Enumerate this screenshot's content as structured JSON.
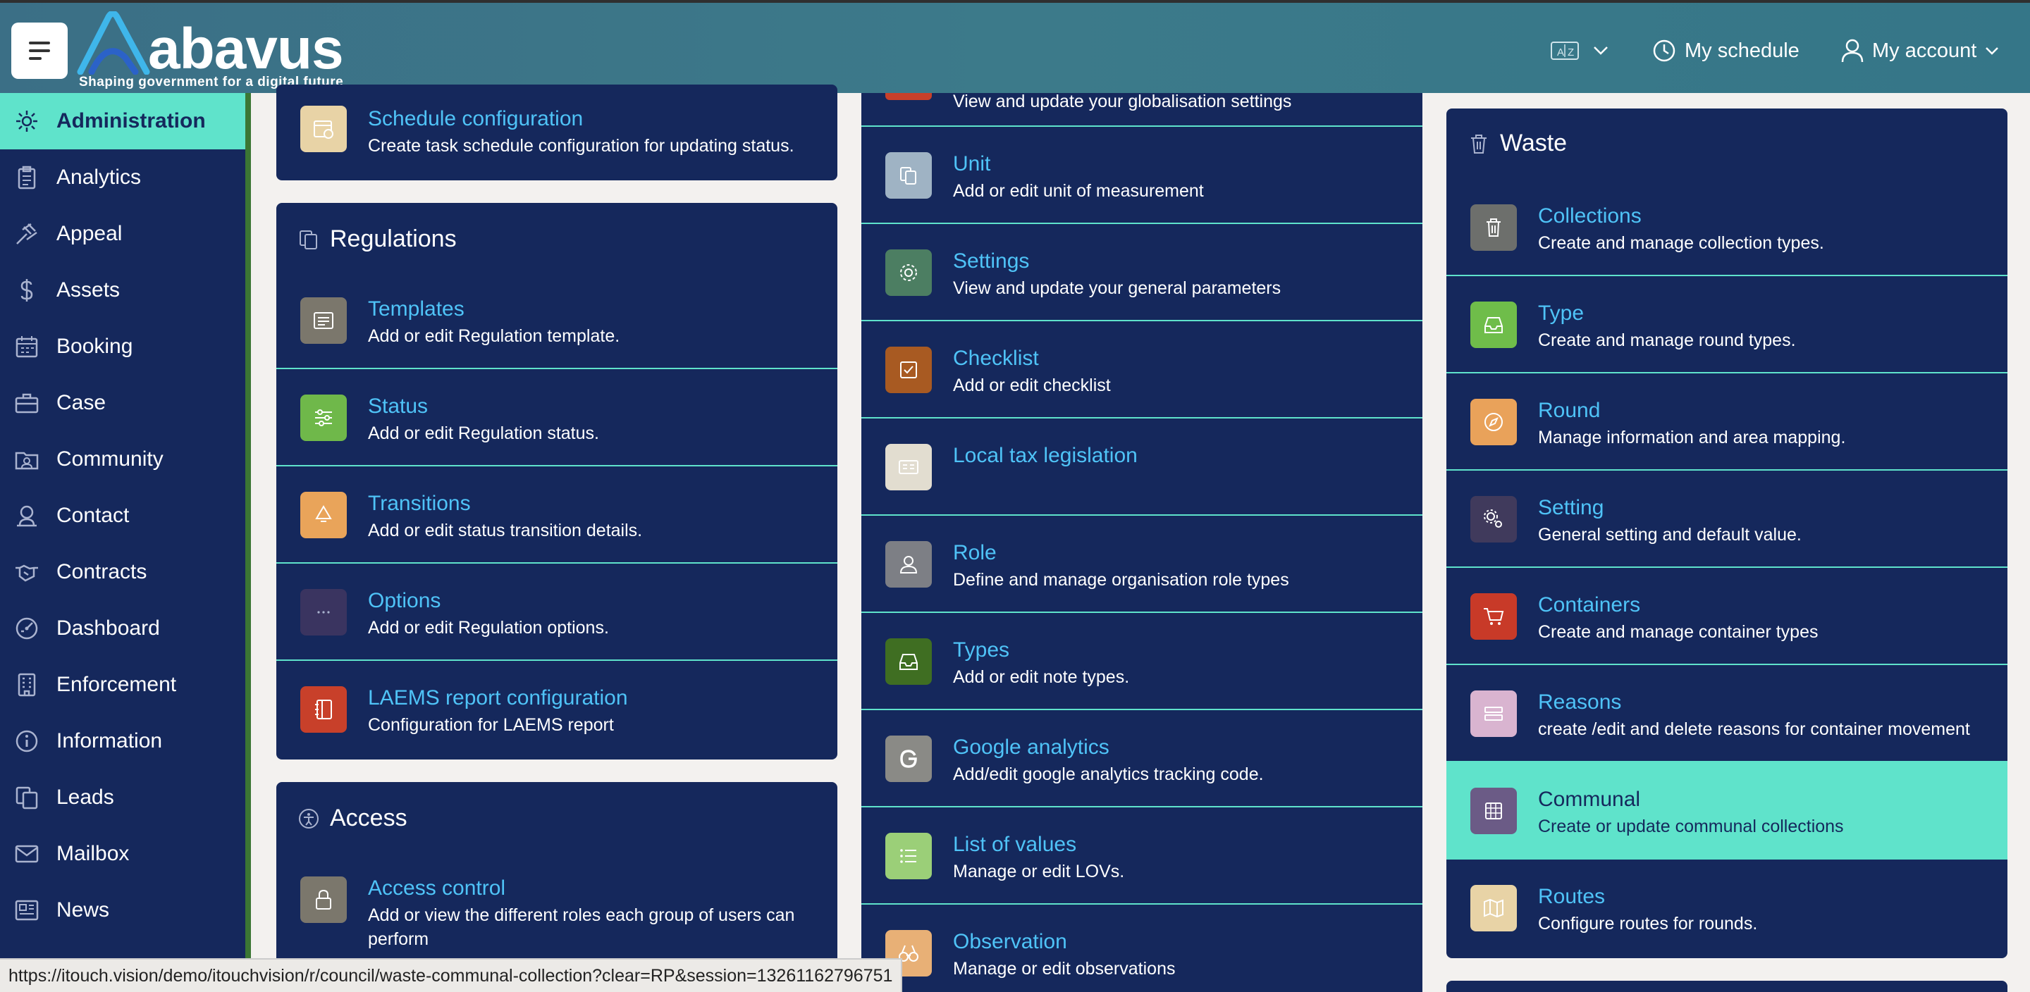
{
  "header": {
    "logo_text": "abavus",
    "tagline": "Shaping government for a digital future",
    "language_icon": "translate-icon",
    "my_schedule": "My schedule",
    "my_account": "My account"
  },
  "sidebar": {
    "items": [
      {
        "label": "Administration",
        "icon": "gear-icon"
      },
      {
        "label": "Analytics",
        "icon": "clipboard-icon"
      },
      {
        "label": "Appeal",
        "icon": "gavel-icon"
      },
      {
        "label": "Assets",
        "icon": "dollar-icon"
      },
      {
        "label": "Booking",
        "icon": "calendar-icon"
      },
      {
        "label": "Case",
        "icon": "briefcase-icon"
      },
      {
        "label": "Community",
        "icon": "community-icon"
      },
      {
        "label": "Contact",
        "icon": "contact-icon"
      },
      {
        "label": "Contracts",
        "icon": "handshake-icon"
      },
      {
        "label": "Dashboard",
        "icon": "dashboard-icon"
      },
      {
        "label": "Enforcement",
        "icon": "building-icon"
      },
      {
        "label": "Information",
        "icon": "info-icon"
      },
      {
        "label": "Leads",
        "icon": "copy-icon"
      },
      {
        "label": "Mailbox",
        "icon": "mail-icon"
      },
      {
        "label": "News",
        "icon": "newspaper-icon"
      }
    ]
  },
  "col1": {
    "schedule": {
      "title": "Schedule configuration",
      "desc": "Create task schedule configuration for updating status."
    },
    "regulations": {
      "title": "Regulations",
      "rows": [
        {
          "title": "Templates",
          "desc": "Add or edit Regulation template."
        },
        {
          "title": "Status",
          "desc": "Add or edit Regulation status."
        },
        {
          "title": "Transitions",
          "desc": "Add or edit status transition details."
        },
        {
          "title": "Options",
          "desc": "Add or edit Regulation options."
        },
        {
          "title": "LAEMS report configuration",
          "desc": "Configuration for LAEMS report"
        }
      ]
    },
    "access": {
      "title": "Access",
      "rows": [
        {
          "title": "Access control",
          "desc": "Add or view the different roles each group of users can perform"
        }
      ]
    }
  },
  "col2": {
    "partial_desc": "View and update your globalisation settings",
    "rows": [
      {
        "title": "Unit",
        "desc": "Add or edit unit of measurement"
      },
      {
        "title": "Settings",
        "desc": "View and update your general parameters"
      },
      {
        "title": "Checklist",
        "desc": "Add or edit checklist"
      },
      {
        "title": "Local tax legislation",
        "desc": ""
      },
      {
        "title": "Role",
        "desc": "Define and manage organisation role types"
      },
      {
        "title": "Types",
        "desc": "Add or edit note types."
      },
      {
        "title": "Google analytics",
        "desc": "Add/edit google analytics tracking code."
      },
      {
        "title": "List of values",
        "desc": "Manage or edit LOVs."
      },
      {
        "title": "Observation",
        "desc": "Manage or edit observations"
      }
    ]
  },
  "col3": {
    "title": "Waste",
    "rows": [
      {
        "title": "Collections",
        "desc": "Create and manage collection types."
      },
      {
        "title": "Type",
        "desc": "Create and manage round types."
      },
      {
        "title": "Round",
        "desc": "Manage information and area mapping."
      },
      {
        "title": "Setting",
        "desc": "General setting and default value."
      },
      {
        "title": "Containers",
        "desc": "Create and manage container types"
      },
      {
        "title": "Reasons",
        "desc": "create /edit and delete reasons for container movement"
      },
      {
        "title": "Communal",
        "desc": "Create or update communal collections"
      },
      {
        "title": "Routes",
        "desc": "Configure routes for rounds."
      }
    ]
  },
  "status_url": "https://itouch.vision/demo/itouchvision/r/council/waste-communal-collection?clear=RP&session=13261162796751",
  "colors": {
    "navy": "#15285c",
    "accent": "#5fe3cb",
    "link": "#4fc3f7",
    "header": "#3c7a8a"
  }
}
